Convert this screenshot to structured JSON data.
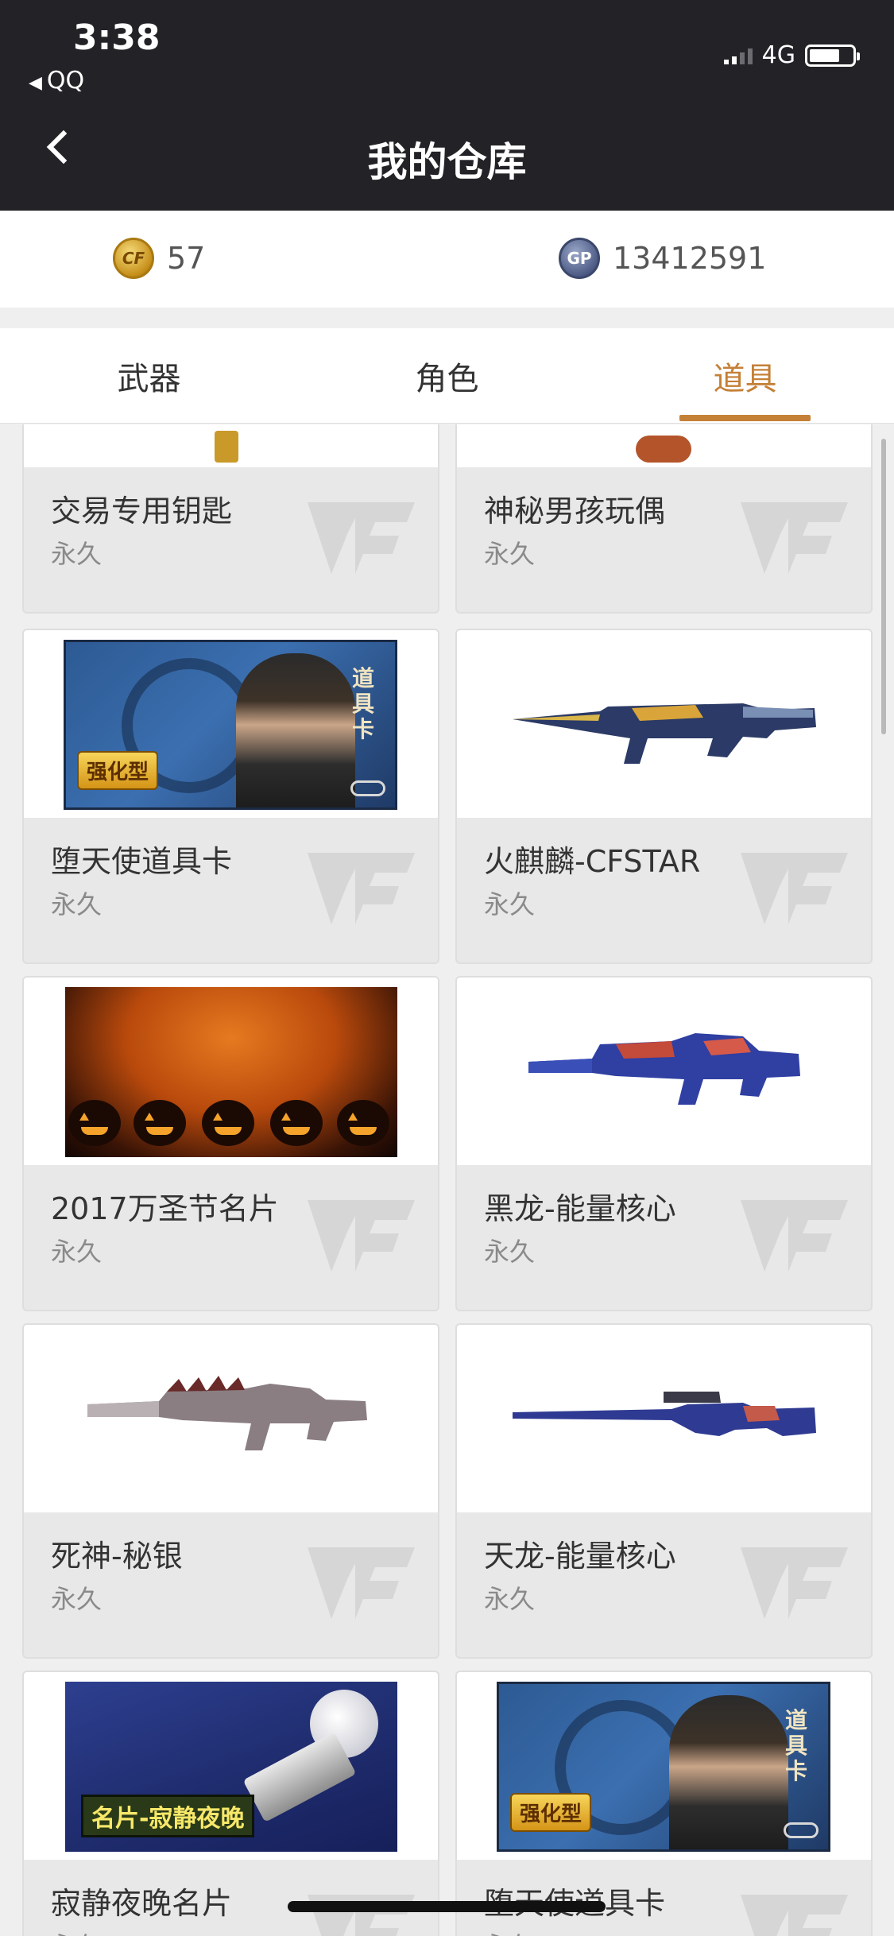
{
  "status_bar": {
    "time": "3:38",
    "back_app": "QQ",
    "network": "4G",
    "icons": [
      "signal-icon",
      "battery-icon"
    ]
  },
  "nav": {
    "title": "我的仓库",
    "back_icon": "chevron-left-icon"
  },
  "currency": {
    "cf_amount": "57",
    "gp_icon_text": "GP",
    "gp_amount": "13412591"
  },
  "tabs": [
    {
      "label": "武器",
      "active": false
    },
    {
      "label": "角色",
      "active": false
    },
    {
      "label": "道具",
      "active": true
    }
  ],
  "accent_color": "#c48036",
  "items": [
    {
      "name": "交易专用钥匙",
      "duration": "永久"
    },
    {
      "name": "神秘男孩玩偶",
      "duration": "永久"
    },
    {
      "name": "堕天使道具卡",
      "duration": "永久"
    },
    {
      "name": "火麒麟-CFSTAR",
      "duration": "永久"
    },
    {
      "name": "2017万圣节名片",
      "duration": "永久"
    },
    {
      "name": "黑龙-能量核心",
      "duration": "永久"
    },
    {
      "name": "死神-秘银",
      "duration": "永久"
    },
    {
      "name": "天龙-能量核心",
      "duration": "永久"
    },
    {
      "name": "寂静夜晚名片",
      "duration": "永久"
    },
    {
      "name": "堕天使道具卡",
      "duration": "永久"
    }
  ],
  "art_text": {
    "card_badge": "强化型",
    "card_label": "道具卡",
    "night_caption": "名片-寂静夜晚"
  }
}
